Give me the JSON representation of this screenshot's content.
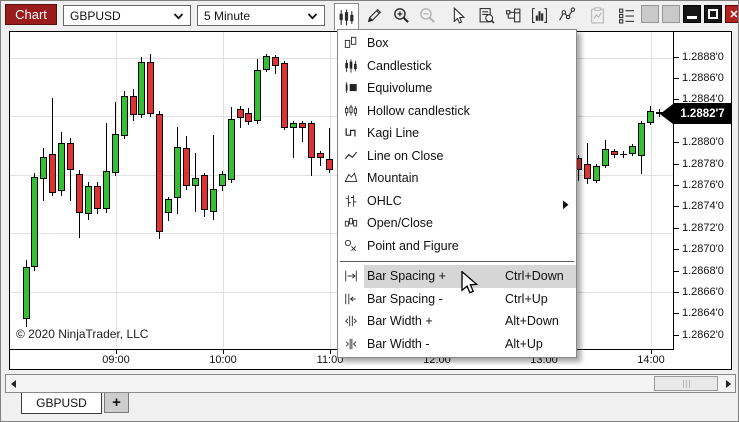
{
  "window": {
    "title": "Chart",
    "title_color": "#9a1b1b",
    "buttons": [
      {
        "name": "window-button-blank-1",
        "glyph": "none",
        "disabled": true
      },
      {
        "name": "window-button-blank-2",
        "glyph": "none",
        "disabled": true
      },
      {
        "name": "minimize-button",
        "glyph": "minimize"
      },
      {
        "name": "maximize-button",
        "glyph": "maximize"
      },
      {
        "name": "close-button",
        "glyph": "close",
        "label": "✕",
        "color": "#b1201f"
      }
    ]
  },
  "toolbar": {
    "instrument": "GBPUSD",
    "interval": "5 Minute",
    "buttons": [
      {
        "name": "chart-style-button",
        "icon": "candlestick-chart-icon",
        "active": true
      },
      {
        "name": "drawing-tools-button",
        "icon": "pencil-icon"
      },
      {
        "name": "zoom-in-button",
        "icon": "zoom-in-icon"
      },
      {
        "name": "zoom-out-button",
        "icon": "zoom-out-icon",
        "disabled": true
      },
      {
        "name": "cursor-button",
        "icon": "cursor-icon"
      },
      {
        "name": "data-box-button",
        "icon": "data-box-icon"
      },
      {
        "name": "chart-trader-button",
        "icon": "chart-trader-icon"
      },
      {
        "name": "indicators-button",
        "icon": "indicators-icon"
      },
      {
        "name": "drawing-line-button",
        "icon": "drawing-line-icon"
      },
      {
        "name": "strategies-button",
        "icon": "strategies-icon",
        "disabled": true
      },
      {
        "name": "properties-button",
        "icon": "properties-icon"
      }
    ]
  },
  "menu": {
    "items": [
      {
        "label": "Box",
        "icon": "box-icon"
      },
      {
        "label": "Candlestick",
        "icon": "candlestick-icon"
      },
      {
        "label": "Equivolume",
        "icon": "equivolume-icon"
      },
      {
        "label": "Hollow candlestick",
        "icon": "hollow-candlestick-icon"
      },
      {
        "label": "Kagi Line",
        "icon": "kagi-line-icon"
      },
      {
        "label": "Line on Close",
        "icon": "line-on-close-icon"
      },
      {
        "label": "Mountain",
        "icon": "mountain-icon"
      },
      {
        "label": "OHLC",
        "icon": "ohlc-icon",
        "submenu": true
      },
      {
        "label": "Open/Close",
        "icon": "open-close-icon"
      },
      {
        "label": "Point and Figure",
        "icon": "point-and-figure-icon"
      },
      {
        "separator": true
      },
      {
        "label": "Bar Spacing +",
        "shortcut": "Ctrl+Down",
        "icon": "bar-spacing-plus-icon",
        "highlighted": true
      },
      {
        "label": "Bar Spacing -",
        "shortcut": "Ctrl+Up",
        "icon": "bar-spacing-minus-icon"
      },
      {
        "label": "Bar Width +",
        "shortcut": "Alt+Down",
        "icon": "bar-width-plus-icon"
      },
      {
        "label": "Bar Width -",
        "shortcut": "Alt+Up",
        "icon": "bar-width-minus-icon"
      }
    ]
  },
  "chart_data": {
    "type": "candlestick",
    "instrument": "GBPUSD",
    "interval": "5 Minute",
    "copyright": "© 2020 NinjaTrader, LLC",
    "last_price_label": "1.2882'7",
    "last_price": 1.28827,
    "up_color": "#33c133",
    "down_color": "#e03232",
    "price_axis_labels": [
      "1.2888'0",
      "1.2886'0",
      "1.2884'0",
      "1.2882'0",
      "1.2880'0",
      "1.2878'0",
      "1.2876'0",
      "1.2874'0",
      "1.2872'0",
      "1.2870'0",
      "1.2868'0",
      "1.2866'0",
      "1.2864'0",
      "1.2862'0"
    ],
    "time_axis_labels": [
      "09:00",
      "10:00",
      "11:00",
      "12:00",
      "13:00",
      "14:00"
    ],
    "candle_columns": [
      "bar_index",
      "open",
      "high",
      "low",
      "close"
    ],
    "candles": [
      [
        0,
        1.28635,
        1.2869,
        1.28628,
        1.28684
      ],
      [
        1,
        1.28684,
        1.28772,
        1.2868,
        1.28768
      ],
      [
        2,
        1.28766,
        1.28795,
        1.28745,
        1.28787
      ],
      [
        3,
        1.28789,
        1.28842,
        1.2875,
        1.28753
      ],
      [
        4,
        1.28755,
        1.2881,
        1.2875,
        1.288
      ],
      [
        5,
        1.288,
        1.28804,
        1.28745,
        1.28774
      ],
      [
        6,
        1.28771,
        1.28774,
        1.28711,
        1.28734
      ],
      [
        7,
        1.28733,
        1.28763,
        1.28728,
        1.28759
      ],
      [
        8,
        1.28759,
        1.28763,
        1.28733,
        1.28738
      ],
      [
        9,
        1.28738,
        1.28818,
        1.28734,
        1.28773
      ],
      [
        10,
        1.28772,
        1.28838,
        1.28769,
        1.28808
      ],
      [
        11,
        1.28806,
        1.28848,
        1.28803,
        1.28844
      ],
      [
        12,
        1.28844,
        1.2885,
        1.2882,
        1.28826
      ],
      [
        13,
        1.28826,
        1.2888,
        1.28823,
        1.28875
      ],
      [
        14,
        1.28875,
        1.28883,
        1.28824,
        1.28827
      ],
      [
        15,
        1.28827,
        1.2883,
        1.2871,
        1.28716
      ],
      [
        16,
        1.28734,
        1.28749,
        1.28727,
        1.28747
      ],
      [
        17,
        1.28748,
        1.28815,
        1.28733,
        1.28796
      ],
      [
        18,
        1.28795,
        1.28806,
        1.28756,
        1.28759
      ],
      [
        19,
        1.28759,
        1.2879,
        1.28735,
        1.28767
      ],
      [
        20,
        1.2877,
        1.28772,
        1.2873,
        1.28737
      ],
      [
        21,
        1.28735,
        1.28807,
        1.28728,
        1.28757
      ],
      [
        22,
        1.28759,
        1.28773,
        1.28755,
        1.28771
      ],
      [
        23,
        1.28765,
        1.28833,
        1.28762,
        1.28822
      ],
      [
        24,
        1.28831,
        1.28834,
        1.28814,
        1.28823
      ],
      [
        25,
        1.28828,
        1.28832,
        1.28816,
        1.28819
      ],
      [
        26,
        1.2882,
        1.28878,
        1.28817,
        1.28868
      ],
      [
        27,
        1.28868,
        1.28883,
        1.28866,
        1.28881
      ],
      [
        28,
        1.2888,
        1.28882,
        1.28864,
        1.28872
      ],
      [
        29,
        1.28874,
        1.28876,
        1.28812,
        1.28814
      ],
      [
        30,
        1.28814,
        1.2882,
        1.28786,
        1.28818
      ],
      [
        31,
        1.28818,
        1.2882,
        1.28801,
        1.28814
      ],
      [
        32,
        1.28818,
        1.2882,
        1.28769,
        1.28786
      ],
      [
        33,
        1.2879,
        1.28792,
        1.28778,
        1.28786
      ],
      [
        34,
        1.28785,
        1.28814,
        1.28772,
        1.28774
      ],
      [
        62,
        1.28786,
        1.28788,
        1.28764,
        1.28774
      ],
      [
        63,
        1.2878,
        1.288,
        1.28761,
        1.28766
      ],
      [
        64,
        1.28764,
        1.2878,
        1.28762,
        1.28778
      ],
      [
        65,
        1.28778,
        1.28802,
        1.28776,
        1.28794
      ],
      [
        66,
        1.28792,
        1.28794,
        1.28786,
        1.28788
      ],
      [
        67,
        1.28789,
        1.28792,
        1.28786,
        1.28789
      ],
      [
        68,
        1.28789,
        1.28799,
        1.28787,
        1.28797
      ],
      [
        69,
        1.28787,
        1.2882,
        1.28771,
        1.28818
      ],
      [
        70,
        1.28818,
        1.28834,
        1.28816,
        1.2883
      ],
      [
        71,
        1.28827,
        1.28831,
        1.28824,
        1.28829
      ]
    ]
  },
  "tabs": {
    "items": [
      {
        "label": "GBPUSD",
        "active": true
      }
    ],
    "add_label": "+"
  }
}
